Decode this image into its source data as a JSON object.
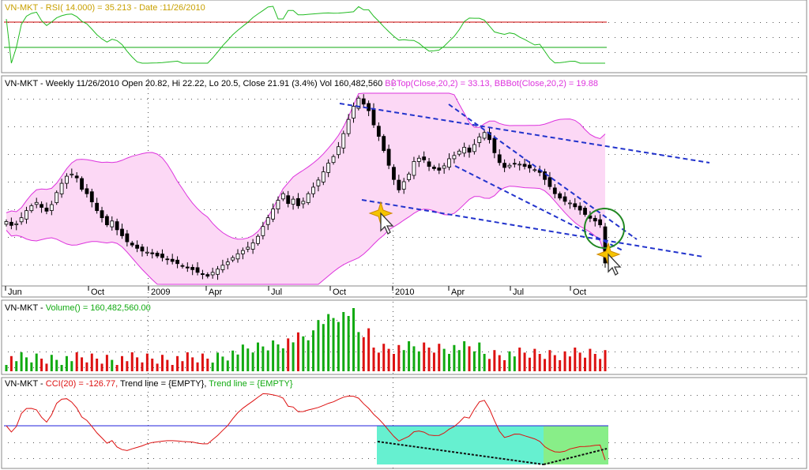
{
  "symbol": "VN-MKT",
  "rsi_panel": {
    "label": "RSI( 14.000) =",
    "value": "35.213",
    "date_text": "- Date :11/26/2010",
    "text_color": "#c8a000",
    "overbought": 70,
    "oversold": 30,
    "line_color": "#22bb22",
    "fill_high_color": "#cc0000",
    "fill_low_color": "#11aa11"
  },
  "price_panel": {
    "header": "- Weekly 11/26/2010 Open 20.82, Hi 22.22, Lo 20.5, Close 21.91 (3.4%) Vol 160,482,560",
    "bbtop": "BBTop(Close,20,2) = 33.13,",
    "bbbot": "BBBot(Close,20,2) = 19.88",
    "band_line_color": "#dd33dd",
    "band_fill_color": "#fcd8f5",
    "x_labels": [
      "Jun",
      "Oct",
      "2009",
      "Apr",
      "Jul",
      "Oct",
      "2010",
      "Apr",
      "Jul",
      "Oct"
    ],
    "trendline_color": "#2233cc"
  },
  "volume_panel": {
    "label": "Volume() = 160,482,560.00",
    "up_color": "#11aa11",
    "down_color": "#dd1111"
  },
  "cci_panel": {
    "label": "CCI(20) = -126.77,",
    "trend1": "Trend line = {EMPTY},",
    "trend2": "Trend line = {EMPTY}",
    "line_color": "#dd1111",
    "zero_line_color": "#2222dd",
    "highlight_colors": [
      "#66f0d0",
      "#88ee88"
    ]
  },
  "chart_data": {
    "type": "candlestick",
    "period": "weekly",
    "x_start": "2008-06",
    "x_end": "2010-11-26",
    "last_bar": {
      "date": "11/26/2010",
      "open": 20.82,
      "high": 22.22,
      "low": 20.5,
      "close": 21.91,
      "change_pct": 3.4,
      "volume": 160482560
    },
    "indicators": {
      "rsi_14": 35.213,
      "bb_top_20_2": 33.13,
      "bb_bot_20_2": 19.88,
      "volume": 160482560,
      "cci_20": -126.77
    },
    "close_series_approx": [
      29.5,
      28.8,
      29.1,
      30.2,
      31.5,
      32.4,
      33.0,
      32.1,
      31.4,
      32.6,
      34.8,
      36.5,
      37.8,
      38.2,
      37.5,
      35.4,
      34.6,
      33.1,
      31.5,
      30.2,
      28.9,
      29.6,
      28.0,
      26.9,
      25.8,
      25.2,
      24.6,
      24.1,
      23.9,
      23.6,
      23.2,
      22.9,
      22.6,
      22.2,
      21.8,
      21.3,
      21.0,
      20.7,
      20.2,
      19.8,
      19.5,
      20.2,
      20.8,
      21.5,
      22.1,
      22.9,
      23.6,
      24.2,
      24.8,
      25.6,
      26.8,
      28.6,
      30.2,
      31.8,
      33.4,
      34.6,
      32.8,
      33.6,
      32.4,
      33.2,
      34.6,
      35.8,
      37.1,
      38.6,
      40.2,
      41.4,
      43.2,
      45.6,
      48.2,
      50.6,
      52.1,
      51.0,
      49.8,
      47.2,
      45.1,
      42.5,
      39.8,
      37.2,
      35.3,
      36.8,
      38.2,
      40.5,
      41.1,
      40.8,
      39.6,
      39.2,
      38.9,
      39.7,
      41.0,
      41.6,
      42.4,
      43.1,
      42.2,
      43.6,
      45.0,
      45.8,
      44.5,
      42.1,
      40.3,
      39.4,
      39.8,
      40.1,
      40.0,
      39.6,
      39.3,
      39.0,
      38.5,
      37.2,
      35.9,
      34.6,
      33.8,
      33.2,
      32.9,
      32.2,
      31.6,
      30.8,
      30.1,
      29.6,
      28.9,
      21.91
    ]
  }
}
